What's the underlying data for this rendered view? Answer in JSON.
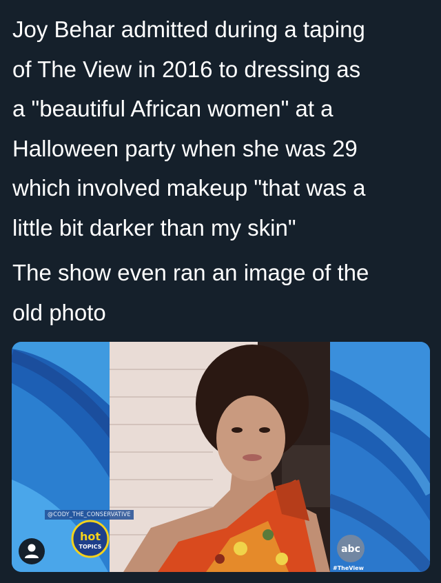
{
  "post": {
    "paragraphs": [
      "Joy Behar admitted during a taping\nof The View in 2016 to dressing as\na \"beautiful African women\" at a\nHalloween party when she was 29\nwhich involved makeup \"that was a\nlittle bit darker than my skin\"",
      "The show even ran an image of the\nold photo"
    ]
  },
  "media": {
    "watermark": "@CODY_THE_CONSERVATIVE",
    "badge_text": "hot",
    "badge_subtext": "TOPICS",
    "network_logo_text": "abc",
    "hashtag": "#TheView",
    "colors": {
      "background_blue": "#1f63b8",
      "light_blue": "#3f9ae0",
      "badge_yellow": "#f5d21c"
    }
  }
}
